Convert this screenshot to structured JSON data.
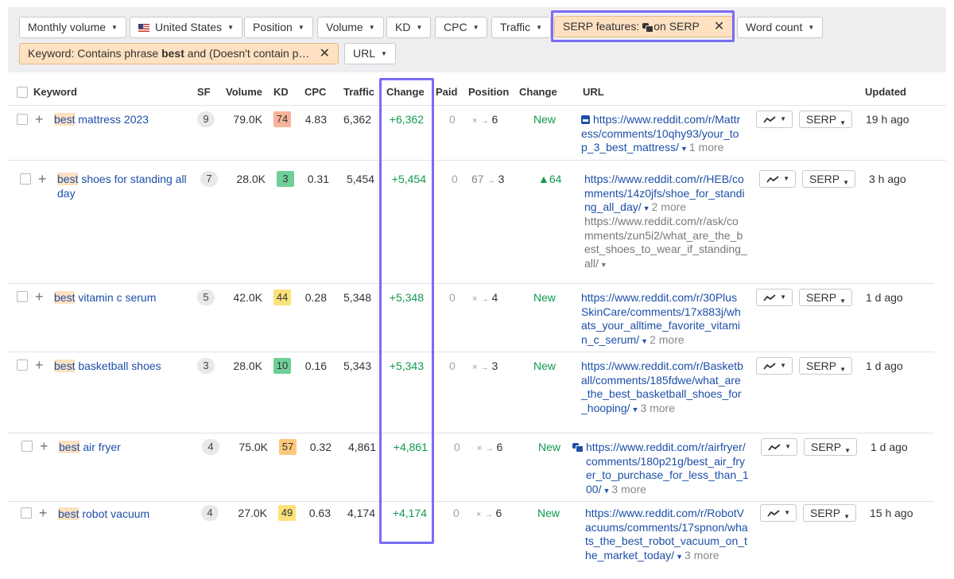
{
  "filters": {
    "monthly_volume": "Monthly volume",
    "country": "United States",
    "position": "Position",
    "volume": "Volume",
    "kd": "KD",
    "cpc": "CPC",
    "traffic": "Traffic",
    "serp_features_prefix": "SERP features:",
    "serp_features_suffix": "on SERP",
    "word_count": "Word count",
    "keyword_filter_prefix": "Keyword: Contains phrase ",
    "keyword_filter_bold": "best",
    "keyword_filter_suffix": " and (Doesn't contain p…",
    "url": "URL"
  },
  "headers": {
    "keyword": "Keyword",
    "sf": "SF",
    "volume": "Volume",
    "kd": "KD",
    "cpc": "CPC",
    "traffic": "Traffic",
    "change": "Change",
    "paid": "Paid",
    "position": "Position",
    "pos_change": "Change",
    "url": "URL",
    "updated": "Updated"
  },
  "colors": {
    "kd_red": "#f7b39a",
    "kd_green": "#6fcf97",
    "kd_yellow": "#fde27a",
    "kd_orange": "#fcc97c",
    "accent": "#7b6cf4",
    "positive": "#0f9a4e",
    "link": "#1d4fa8"
  },
  "rows": [
    {
      "kw_hl": "best",
      "kw_rest": " mattress 2023",
      "sf": "9",
      "volume": "79.0K",
      "kd": "74",
      "cpc": "4.83",
      "traffic": "6,362",
      "change": "+6,362",
      "paid": "0",
      "pos_from": "×",
      "pos_to": "6",
      "pos_change": "New",
      "url_icon": "image-icon",
      "url": "https://www.reddit.com/r/Mattress/comments/10qhy93/your_top_3_best_mattress/",
      "more": "1 more",
      "serp": "SERP",
      "updated": "19 h ago"
    },
    {
      "kw_hl": "best",
      "kw_rest": " shoes for standing all day",
      "sf": "7",
      "volume": "28.0K",
      "kd": "3",
      "cpc": "0.31",
      "traffic": "5,454",
      "change": "+5,454",
      "paid": "0",
      "pos_from": "67",
      "pos_to": "3",
      "pos_change": "▲64",
      "url": "https://www.reddit.com/r/HEB/comments/14z0jfs/shoe_for_standing_all_day/",
      "more": "2 more",
      "url2": "https://www.reddit.com/r/ask/comments/zun5i2/what_are_the_best_shoes_to_wear_if_standing_all/",
      "serp": "SERP",
      "updated": "3 h ago"
    },
    {
      "kw_hl": "best",
      "kw_rest": " vitamin c serum",
      "sf": "5",
      "volume": "42.0K",
      "kd": "44",
      "cpc": "0.28",
      "traffic": "5,348",
      "change": "+5,348",
      "paid": "0",
      "pos_from": "×",
      "pos_to": "4",
      "pos_change": "New",
      "url": "https://www.reddit.com/r/30PlusSkinCare/comments/17x883j/whats_your_alltime_favorite_vitamin_c_serum/",
      "more": "2 more",
      "serp": "SERP",
      "updated": "1 d ago"
    },
    {
      "kw_hl": "best",
      "kw_rest": " basketball shoes",
      "sf": "3",
      "volume": "28.0K",
      "kd": "10",
      "cpc": "0.16",
      "traffic": "5,343",
      "change": "+5,343",
      "paid": "0",
      "pos_from": "×",
      "pos_to": "3",
      "pos_change": "New",
      "url": "https://www.reddit.com/r/Basketball/comments/185fdwe/what_are_the_best_basketball_shoes_for_hooping/",
      "more": "3 more",
      "serp": "SERP",
      "updated": "1 d ago"
    },
    {
      "kw_hl": "best",
      "kw_rest": " air fryer",
      "sf": "4",
      "volume": "75.0K",
      "kd": "57",
      "cpc": "0.32",
      "traffic": "4,861",
      "change": "+4,861",
      "paid": "0",
      "pos_from": "×",
      "pos_to": "6",
      "pos_change": "New",
      "url_icon": "discussion-icon",
      "url": "https://www.reddit.com/r/airfryer/comments/180p21g/best_air_fryer_to_purchase_for_less_than_100/",
      "more": "3 more",
      "serp": "SERP",
      "updated": "1 d ago"
    },
    {
      "kw_hl": "best",
      "kw_rest": " robot vacuum",
      "sf": "4",
      "volume": "27.0K",
      "kd": "49",
      "cpc": "0.63",
      "traffic": "4,174",
      "change": "+4,174",
      "paid": "0",
      "pos_from": "×",
      "pos_to": "6",
      "pos_change": "New",
      "url": "https://www.reddit.com/r/RobotVacuums/comments/17spnon/whats_the_best_robot_vacuum_on_the_market_today/",
      "more": "3 more",
      "serp": "SERP",
      "updated": "15 h ago"
    }
  ]
}
